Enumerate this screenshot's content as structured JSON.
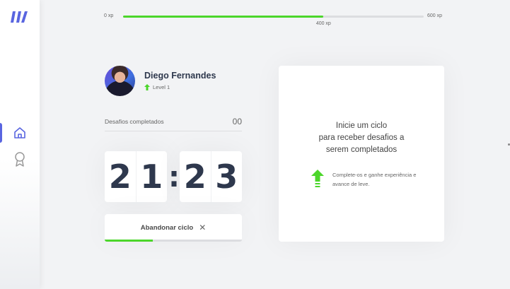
{
  "colors": {
    "accent": "#5965e0",
    "success": "#4cd62b",
    "title": "#2e384d",
    "text": "#666666",
    "background": "#f2f3f5"
  },
  "sidebar": {
    "logo_icon": "logo-icon",
    "items": [
      {
        "icon": "home-icon",
        "active": true
      },
      {
        "icon": "award-icon",
        "active": false
      }
    ]
  },
  "xp_bar": {
    "min_label": "0 xp",
    "max_label": "600 xp",
    "current_label": "400 xp",
    "current": 400,
    "max": 600
  },
  "profile": {
    "name": "Diego Fernandes",
    "level_label": "Level 1",
    "level_icon": "level-up-icon"
  },
  "challenges": {
    "label": "Desafios completados",
    "count": "00"
  },
  "countdown": {
    "minutes": [
      "2",
      "1"
    ],
    "separator": ":",
    "seconds": [
      "2",
      "3"
    ]
  },
  "abandon_button": {
    "label": "Abandonar ciclo",
    "icon": "close-icon",
    "progress_fraction": 0.35
  },
  "challenge_card": {
    "title_lines": [
      "Inicie um ciclo",
      "para receber desafios a",
      "serem completados"
    ],
    "hint_icon": "level-up-icon",
    "hint_text": "Complete-os e ganhe experiência e avance de leve."
  }
}
